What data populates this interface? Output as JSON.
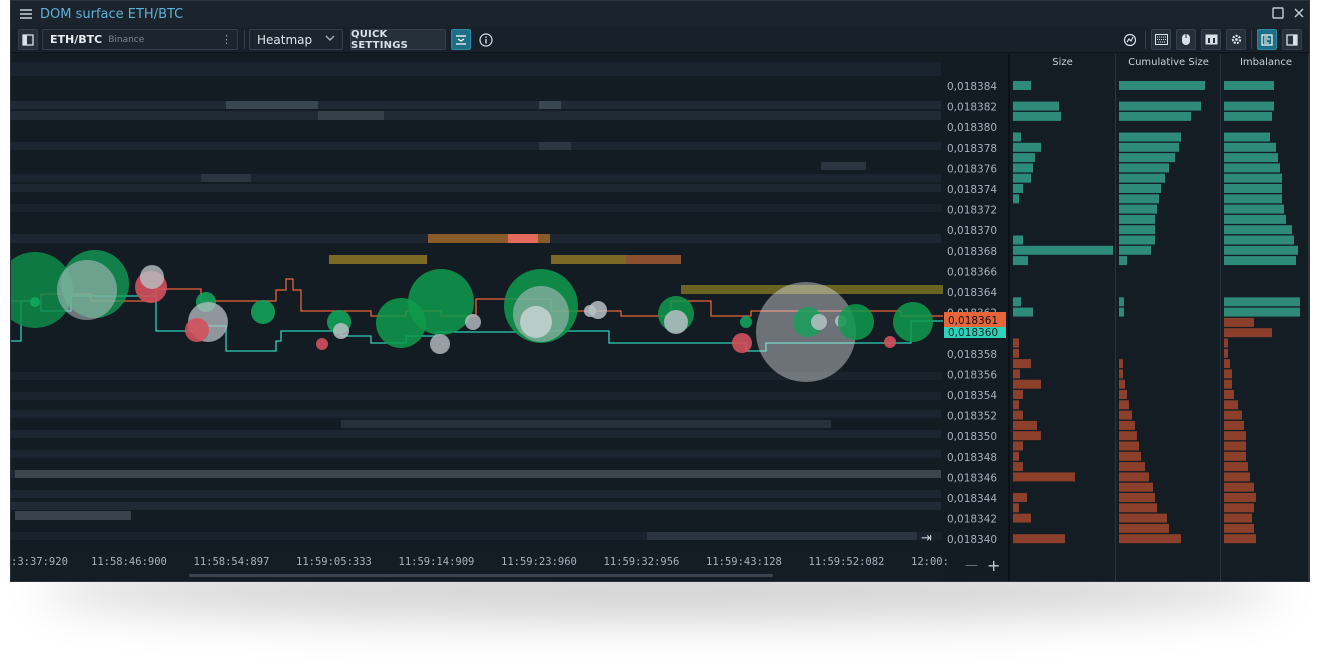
{
  "window": {
    "title": "DOM surface ETH/BTC"
  },
  "toolbar": {
    "symbol": "ETH/BTC",
    "exchange": "Binance",
    "symbol_menu": "⋮",
    "view_mode": "Heatmap",
    "quick_settings_label": "QUICK SETTINGS",
    "icons": [
      "sidebar-toggle-icon",
      "chevron-down-icon",
      "filter-settings-icon",
      "info-icon",
      "tracking-icon",
      "keyboard-icon",
      "mouse-icon",
      "layout-icon",
      "gear-icon",
      "left-panel-icon",
      "right-panel-icon"
    ]
  },
  "price_axis": {
    "labels": [
      "0,018384",
      "0,018382",
      "0,018380",
      "0,018378",
      "0,018376",
      "0,018374",
      "0,018372",
      "0,018370",
      "0,018368",
      "0,018366",
      "0,018364",
      "0,018362",
      "0,018360",
      "0,018358",
      "0,018356",
      "0,018354",
      "0,018352",
      "0,018350",
      "0,018348",
      "0,018346",
      "0,018344",
      "0,018342",
      "0,018340"
    ],
    "ask_price": "0,018361",
    "bid_price": "0,018360",
    "ask_color": "#e8653a",
    "bid_color": "#2fd1b8"
  },
  "time_axis": {
    "labels": [
      ":3:37:920",
      "11:58:46:900",
      "11:58:54:897",
      "11:59:05:333",
      "11:59:14:909",
      "11:59:23:960",
      "11:59:32:956",
      "11:59:43:128",
      "11:59:52:082",
      "12:00:"
    ],
    "zoom_out": "—",
    "zoom_in": "+",
    "scroll_end": "⇥"
  },
  "dom_panel": {
    "columns": [
      "Size",
      "Cumulative Size",
      "Imbalance"
    ],
    "colors": {
      "bid": "#2e8a79",
      "ask": "#8c3f2a"
    }
  }
}
